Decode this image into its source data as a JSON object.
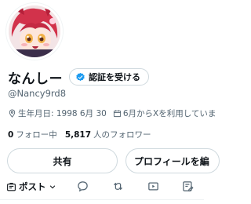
{
  "profile": {
    "display_name": "なんしー",
    "verify_label": "認証を受ける",
    "handle": "@Nancy9rd8",
    "birthday": "生年月日: 1998 6月 30",
    "joined": "6月からXを利用していま",
    "following_count": "0",
    "following_label": "フォロー中",
    "followers_count": "5,817",
    "followers_label": "人のフォロワー"
  },
  "actions": {
    "share_label": "共有",
    "edit_profile_label": "プロフィールを編"
  },
  "tabs": {
    "post_label": "ポスト",
    "icons": [
      "reply-icon",
      "retweet-icon",
      "media-icon",
      "edit-icon"
    ]
  },
  "colors": {
    "accent": "#1d9bf0",
    "text": "#0f1419",
    "muted": "#536471",
    "border": "#cfd9de"
  }
}
